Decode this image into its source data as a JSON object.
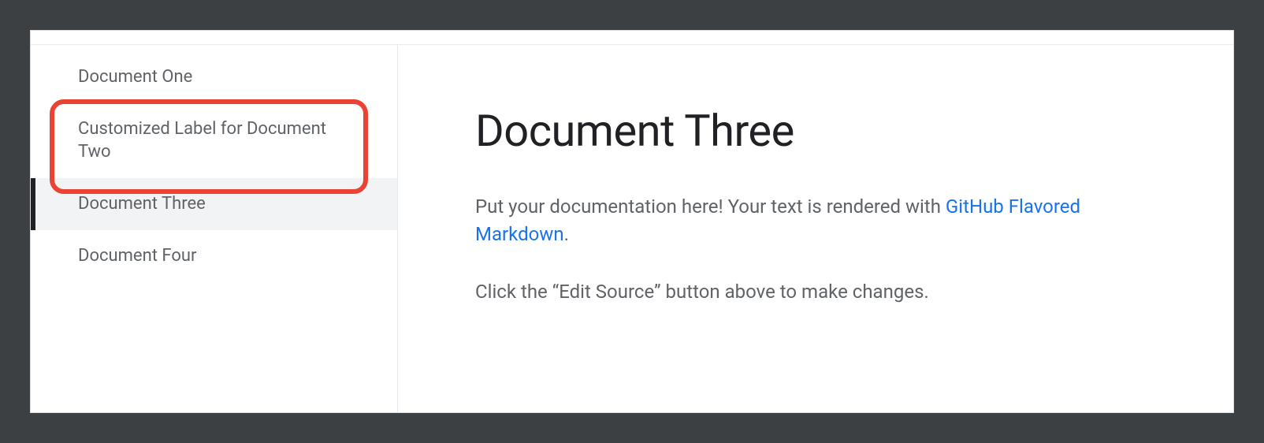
{
  "sidebar": {
    "items": [
      {
        "label": "Document One",
        "active": false
      },
      {
        "label": "Customized Label for Document Two",
        "active": false,
        "highlighted": true
      },
      {
        "label": "Document Three",
        "active": true
      },
      {
        "label": "Document Four",
        "active": false
      }
    ]
  },
  "main": {
    "title": "Document Three",
    "paragraph1_prefix": "Put your documentation here! Your text is rendered with ",
    "paragraph1_link": "GitHub Flavored Markdown",
    "paragraph1_suffix": ".",
    "paragraph2": "Click the “Edit Source” button above to make changes."
  }
}
